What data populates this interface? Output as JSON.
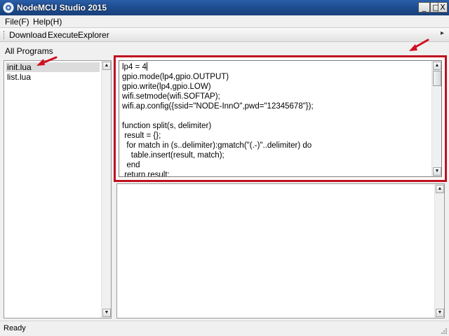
{
  "window": {
    "title": "NodeMCU Studio 2015",
    "minimize_glyph": "_",
    "maximize_glyph": "□",
    "close_glyph": "X"
  },
  "menu": {
    "file": "File(F)",
    "help": "Help(H)"
  },
  "toolbar": {
    "download": "Download",
    "execute": "Execute",
    "explorer": "Explorer",
    "overflow_glyph": "▸"
  },
  "programs": {
    "heading": "All Programs",
    "files": [
      {
        "name": "init.lua",
        "selected": true
      },
      {
        "name": "list.lua",
        "selected": false
      }
    ]
  },
  "editor": {
    "lines": [
      "lp4 = 4",
      "gpio.mode(lp4,gpio.OUTPUT)",
      "gpio.write(lp4,gpio.LOW)",
      "wifi.setmode(wifi.SOFTAP);",
      "wifi.ap.config({ssid=\"NODE-InnO\",pwd=\"12345678\"});",
      "",
      "function split(s, delimiter)",
      " result = {};",
      "  for match in (s..delimiter):gmatch(\"(.-)\"..delimiter) do",
      "    table.insert(result, match);",
      "  end",
      " return result;"
    ]
  },
  "scrollbar": {
    "up_glyph": "▲",
    "down_glyph": "▼"
  },
  "status": {
    "text": "Ready"
  },
  "colors": {
    "title_bar": "#1f4e92",
    "highlight": "#c01020",
    "selection": "#dcdcdc"
  }
}
